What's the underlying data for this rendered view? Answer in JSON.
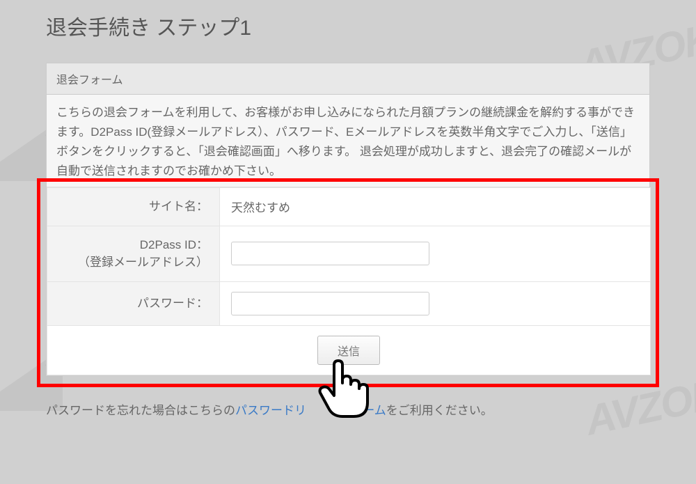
{
  "pageTitle": "退会手続き ステップ1",
  "panel": {
    "header": "退会フォーム",
    "description": "こちらの退会フォームを利用して、お客様がお申し込みになられた月額プランの継続課金を解約する事ができます。D2Pass ID(登録メールアドレス）、パスワード、Eメールアドレスを英数半角文字でご入力し、「送信」ボタンをクリックすると、「退会確認画面」へ移ります。 退会処理が成功しますと、退会完了の確認メールが自動で送信されますのでお確かめ下さい。"
  },
  "form": {
    "siteNameLabel": "サイト名：",
    "siteNameValue": "天然むすめ",
    "d2passLabel1": "D2Pass ID：",
    "d2passLabel2": "（登録メールアドレス）",
    "passwordLabel": "パスワード：",
    "submitLabel": "送信"
  },
  "footer": {
    "before": "パスワードを忘れた場合はこちらの",
    "linkPart1": "パスワードリ",
    "linkPart2": "フォーム",
    "after": "をご利用ください。"
  },
  "watermark": "AVZOK"
}
